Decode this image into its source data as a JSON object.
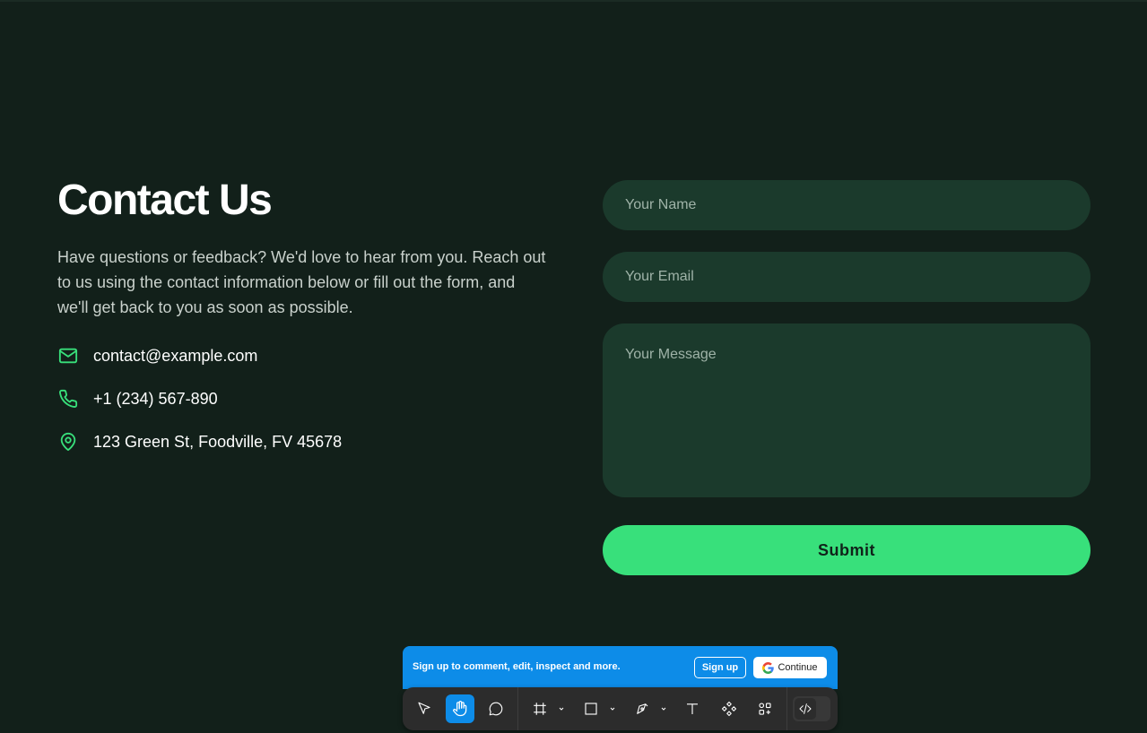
{
  "contact": {
    "title": "Contact Us",
    "description": "Have questions or feedback? We'd love to hear from you. Reach out to us using the contact information below or fill out the form, and we'll get back to you as soon as possible.",
    "items": [
      {
        "icon": "mail-icon",
        "text": "contact@example.com"
      },
      {
        "icon": "phone-icon",
        "text": "+1 (234) 567-890"
      },
      {
        "icon": "map-pin-icon",
        "text": "123 Green St, Foodville, FV 45678"
      }
    ]
  },
  "form": {
    "name_placeholder": "Your Name",
    "email_placeholder": "Your Email",
    "message_placeholder": "Your Message",
    "name_value": "",
    "email_value": "",
    "message_value": "",
    "submit_label": "Submit"
  },
  "figma_overlay": {
    "banner_message": "Sign up to comment, edit, inspect and more.",
    "signup_label": "Sign up",
    "continue_label": "Continue",
    "tools": [
      "move-tool-icon",
      "hand-tool-icon",
      "comment-tool-icon",
      "frame-tool-icon",
      "rectangle-tool-icon",
      "pen-tool-icon",
      "text-tool-icon",
      "component-tool-icon",
      "apps-icon",
      "dev-mode-icon"
    ],
    "active_tool": "hand-tool-icon"
  },
  "colors": {
    "background": "#12201a",
    "field": "#1b3a2c",
    "accent": "#38e07b",
    "figma_blue": "#0d8ce8"
  }
}
